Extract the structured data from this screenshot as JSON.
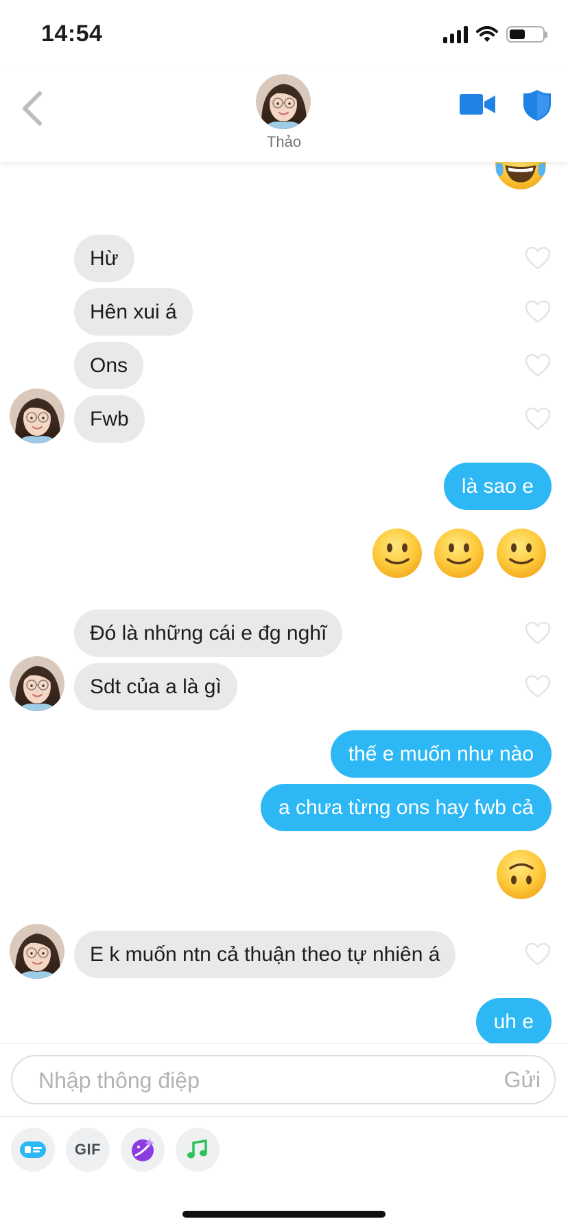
{
  "status_bar": {
    "time": "14:54"
  },
  "header": {
    "contact_name": "Thảo"
  },
  "messages": [
    {
      "id": "m1",
      "from": "contact",
      "text": "Hừ"
    },
    {
      "id": "m2",
      "from": "contact",
      "text": "Hên xui á"
    },
    {
      "id": "m3",
      "from": "contact",
      "text": "Ons"
    },
    {
      "id": "m4",
      "from": "contact",
      "text": "Fwb"
    },
    {
      "id": "m5",
      "from": "me",
      "text": "là sao e"
    },
    {
      "id": "m6",
      "from": "me",
      "emoji": [
        "slightly-smiling-face",
        "slightly-smiling-face",
        "slightly-smiling-face"
      ]
    },
    {
      "id": "m7",
      "from": "contact",
      "text": "Đó là những cái e đg nghĩ"
    },
    {
      "id": "m8",
      "from": "contact",
      "text": "Sdt của a là gì"
    },
    {
      "id": "m9",
      "from": "me",
      "text": "thế e muốn như nào"
    },
    {
      "id": "m10",
      "from": "me",
      "text": "a chưa từng ons hay fwb cả"
    },
    {
      "id": "m11",
      "from": "me",
      "emoji": [
        "upside-down-face"
      ]
    },
    {
      "id": "m12",
      "from": "contact",
      "text": "E k muốn ntn cả thuận theo tự nhiên á"
    },
    {
      "id": "m13",
      "from": "me",
      "text": "uh e"
    }
  ],
  "top_emoji": "face-with-tears-of-joy",
  "composer": {
    "placeholder": "Nhập thông điệp",
    "send_label": "Gửi"
  },
  "toolbar": {
    "gif_label": "GIF",
    "tools": [
      "card-icon",
      "gif-icon",
      "sticker-icon",
      "music-icon"
    ]
  },
  "colors": {
    "outgoing_bubble": "#2db8f5",
    "incoming_bubble": "#e9e9eb",
    "accent": "#2182e6"
  }
}
